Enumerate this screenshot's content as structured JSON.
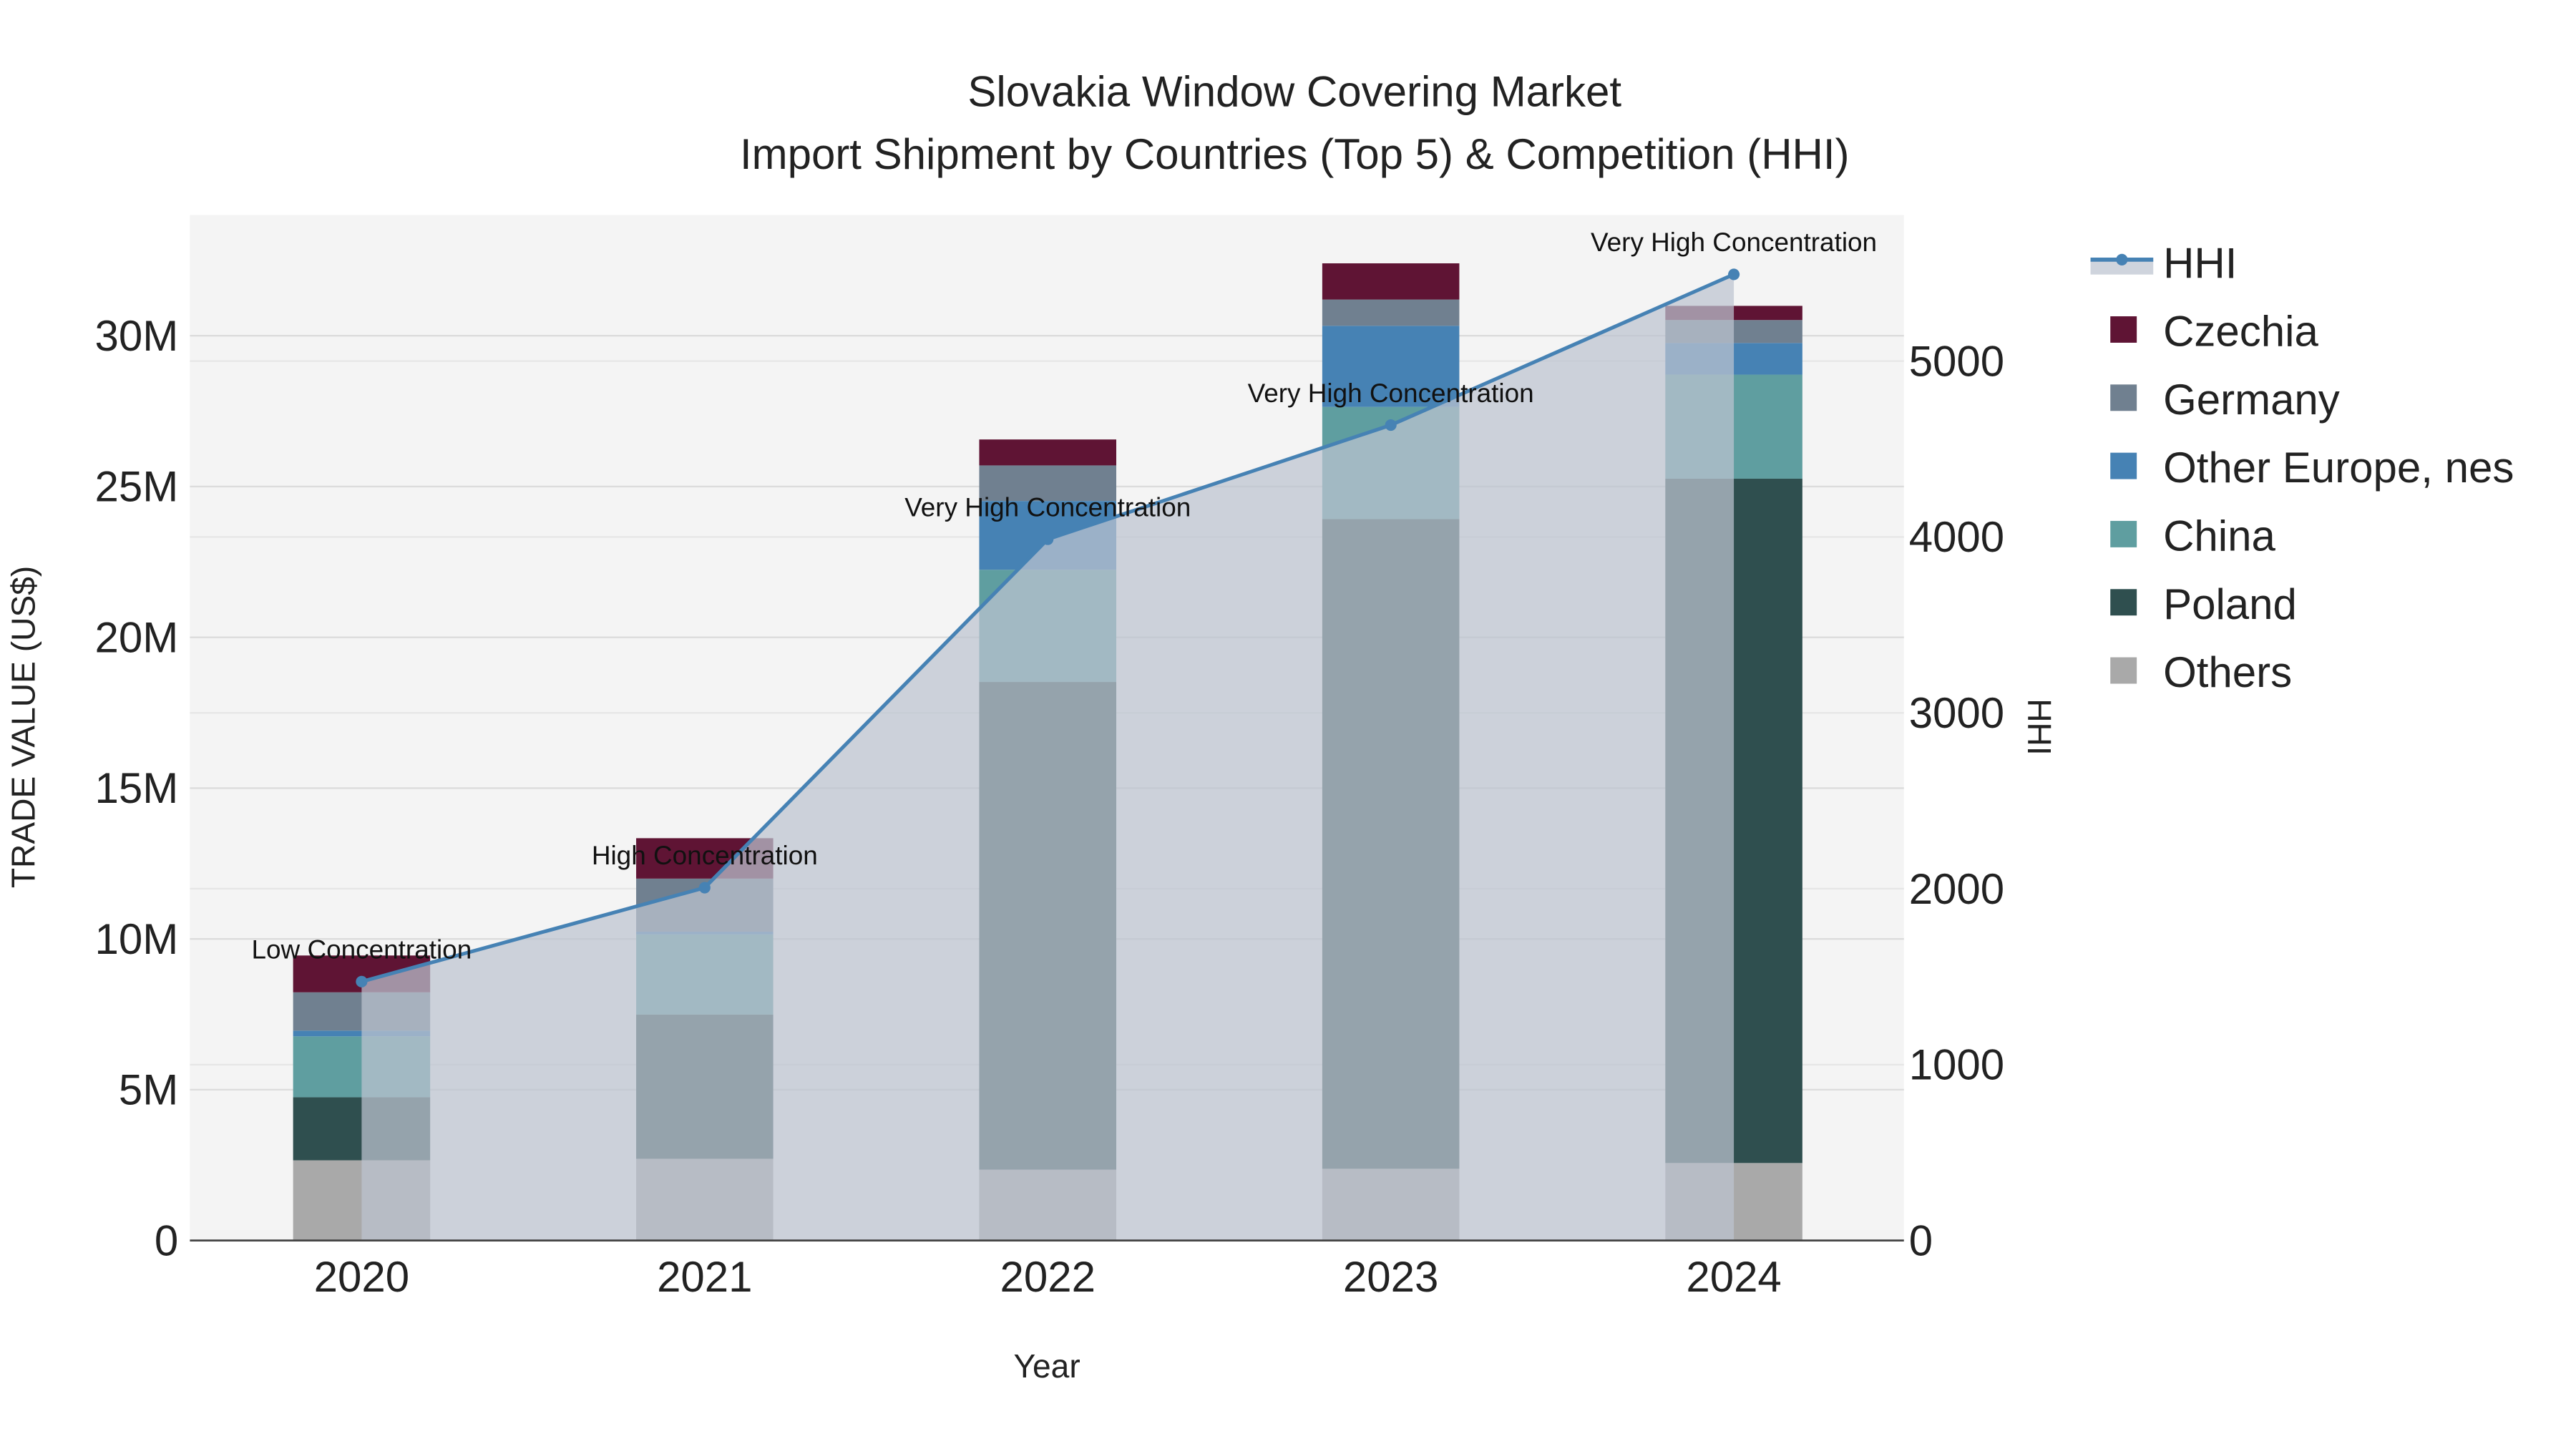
{
  "chart_data": {
    "type": "bar",
    "title": "Slovakia Window Covering Market",
    "subtitle": "Import Shipment by Countries (Top 5) & Competition (HHI)",
    "xlabel": "Year",
    "ylabel": "TRADE VALUE (US$)",
    "y2label": "HHI",
    "categories": [
      "2020",
      "2021",
      "2022",
      "2023",
      "2024"
    ],
    "ylim": [
      0,
      34000000
    ],
    "y2lim": [
      0,
      5830
    ],
    "yticks": [
      {
        "v": 0,
        "label": "0"
      },
      {
        "v": 5000000,
        "label": "5M"
      },
      {
        "v": 10000000,
        "label": "10M"
      },
      {
        "v": 15000000,
        "label": "15M"
      },
      {
        "v": 20000000,
        "label": "20M"
      },
      {
        "v": 25000000,
        "label": "25M"
      },
      {
        "v": 30000000,
        "label": "30M"
      }
    ],
    "y2ticks": [
      {
        "v": 0,
        "label": "0"
      },
      {
        "v": 1000,
        "label": "1000"
      },
      {
        "v": 2000,
        "label": "2000"
      },
      {
        "v": 3000,
        "label": "3000"
      },
      {
        "v": 4000,
        "label": "4000"
      },
      {
        "v": 5000,
        "label": "5000"
      }
    ],
    "grid": true,
    "legend_position": "right",
    "series": [
      {
        "name": "Others",
        "color": "#a9a9a9",
        "values": [
          2660000,
          2710000,
          2350000,
          2380000,
          2570000
        ]
      },
      {
        "name": "Poland",
        "color": "#2f4f4f",
        "values": [
          2090000,
          4780000,
          16170000,
          21540000,
          22690000
        ]
      },
      {
        "name": "China",
        "color": "#5f9ea0",
        "values": [
          2020000,
          2660000,
          3720000,
          3720000,
          3450000
        ]
      },
      {
        "name": "Other Europe, nes",
        "color": "#4682b4",
        "values": [
          190000,
          90000,
          2280000,
          2690000,
          1050000
        ]
      },
      {
        "name": "Germany",
        "color": "#708090",
        "values": [
          1270000,
          1760000,
          1180000,
          870000,
          760000
        ]
      },
      {
        "name": "Czechia",
        "color": "#5f1434",
        "values": [
          1220000,
          1340000,
          860000,
          1200000,
          470000
        ]
      }
    ],
    "hhi": {
      "name": "HHI",
      "color": "#4682b4",
      "values": [
        1472,
        2006,
        3987,
        4636,
        5493
      ],
      "annotations": [
        "Low Concentration",
        "High Concentration",
        "Very High Concentration",
        "Very High Concentration",
        "Very High Concentration"
      ]
    },
    "legend_order": [
      "HHI",
      "Czechia",
      "Germany",
      "Other Europe, nes",
      "China",
      "Poland",
      "Others"
    ]
  }
}
